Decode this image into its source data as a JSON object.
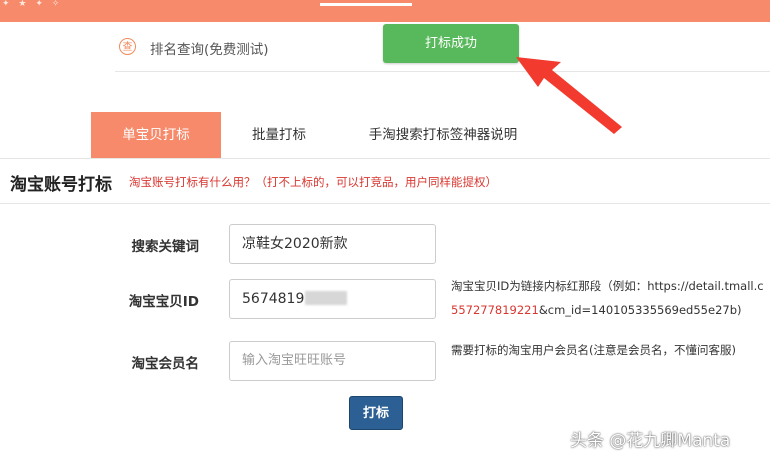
{
  "top_bar": {
    "accent": "#f68a6a",
    "dots": "✦ ★ ✦ ✧"
  },
  "rank_query": {
    "icon": "rank-icon",
    "icon_glyph": "查",
    "label": "排名查询(免费测试)"
  },
  "success_button": {
    "label": "打标成功",
    "color": "#58b85c"
  },
  "tabs": [
    {
      "label": "单宝贝打标",
      "active": true
    },
    {
      "label": "批量打标",
      "active": false
    },
    {
      "label": "手淘搜索打标签神器说明",
      "active": false
    }
  ],
  "section": {
    "title": "淘宝账号打标",
    "note": "淘宝账号打标有什么用？（打不上标的，可以打竞品，用户同样能提权）"
  },
  "form": {
    "keyword": {
      "label": "搜索关键词",
      "value": "凉鞋女2020新款"
    },
    "item_id": {
      "label": "淘宝宝贝ID",
      "value": "5674819",
      "help_line1": "淘宝宝贝ID为链接内标红那段（例如：https://detail.tmall.c",
      "help_line2_red": "557277819221",
      "help_line2_rest": "&cm_id=140105335569ed55e27b)"
    },
    "member": {
      "label": "淘宝会员名",
      "placeholder": "输入淘宝旺旺账号",
      "help": "需要打标的淘宝用户会员名(注意是会员名，不懂问客服)"
    },
    "submit_label": "打标"
  },
  "watermark": "头条 @花九卿Manta"
}
